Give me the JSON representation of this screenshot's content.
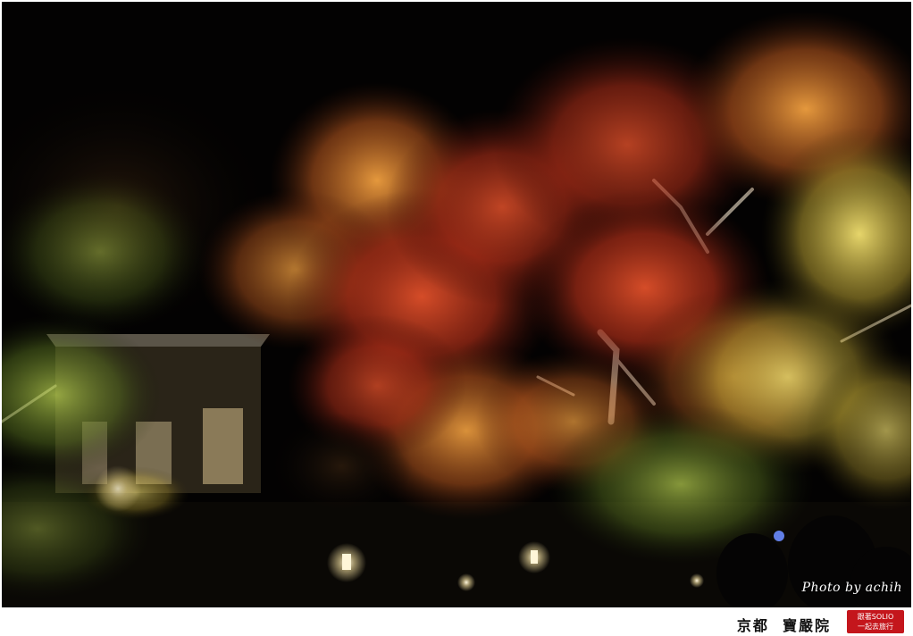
{
  "photo": {
    "description_icon": "autumn-maple-night-icon",
    "colors": {
      "sky": "#030202",
      "maple_red": "#a8321a",
      "maple_orange": "#d9742a",
      "maple_yellow": "#d8c24a",
      "maple_green": "#8fa83a",
      "lantern": "#fff6d8"
    }
  },
  "watermark": {
    "text": "Photo by achih"
  },
  "caption": {
    "text": "京都  寶嚴院"
  },
  "stamp": {
    "line1": "跟著SOLIO",
    "line2": "一起去旅行",
    "color": "#c4161c"
  }
}
